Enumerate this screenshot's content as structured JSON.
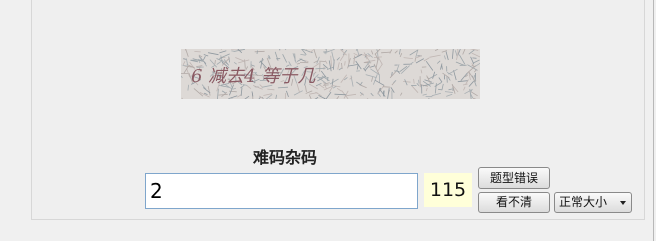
{
  "captcha": {
    "question": "6 减去4 等于几"
  },
  "form": {
    "heading": "难码杂码",
    "answer_value": "2",
    "timer_value": "115"
  },
  "buttons": {
    "report_label": "题型错误",
    "refresh_label": "看不清"
  },
  "size_select": {
    "selected": "正常大小"
  },
  "icons": {
    "dropdown": "chevron-down-icon"
  },
  "colors": {
    "captcha_text": "#8a5a63",
    "captcha_bg": "#ddd9d6",
    "timer_bg": "#ffffd9",
    "input_border": "#7fa6cc"
  }
}
